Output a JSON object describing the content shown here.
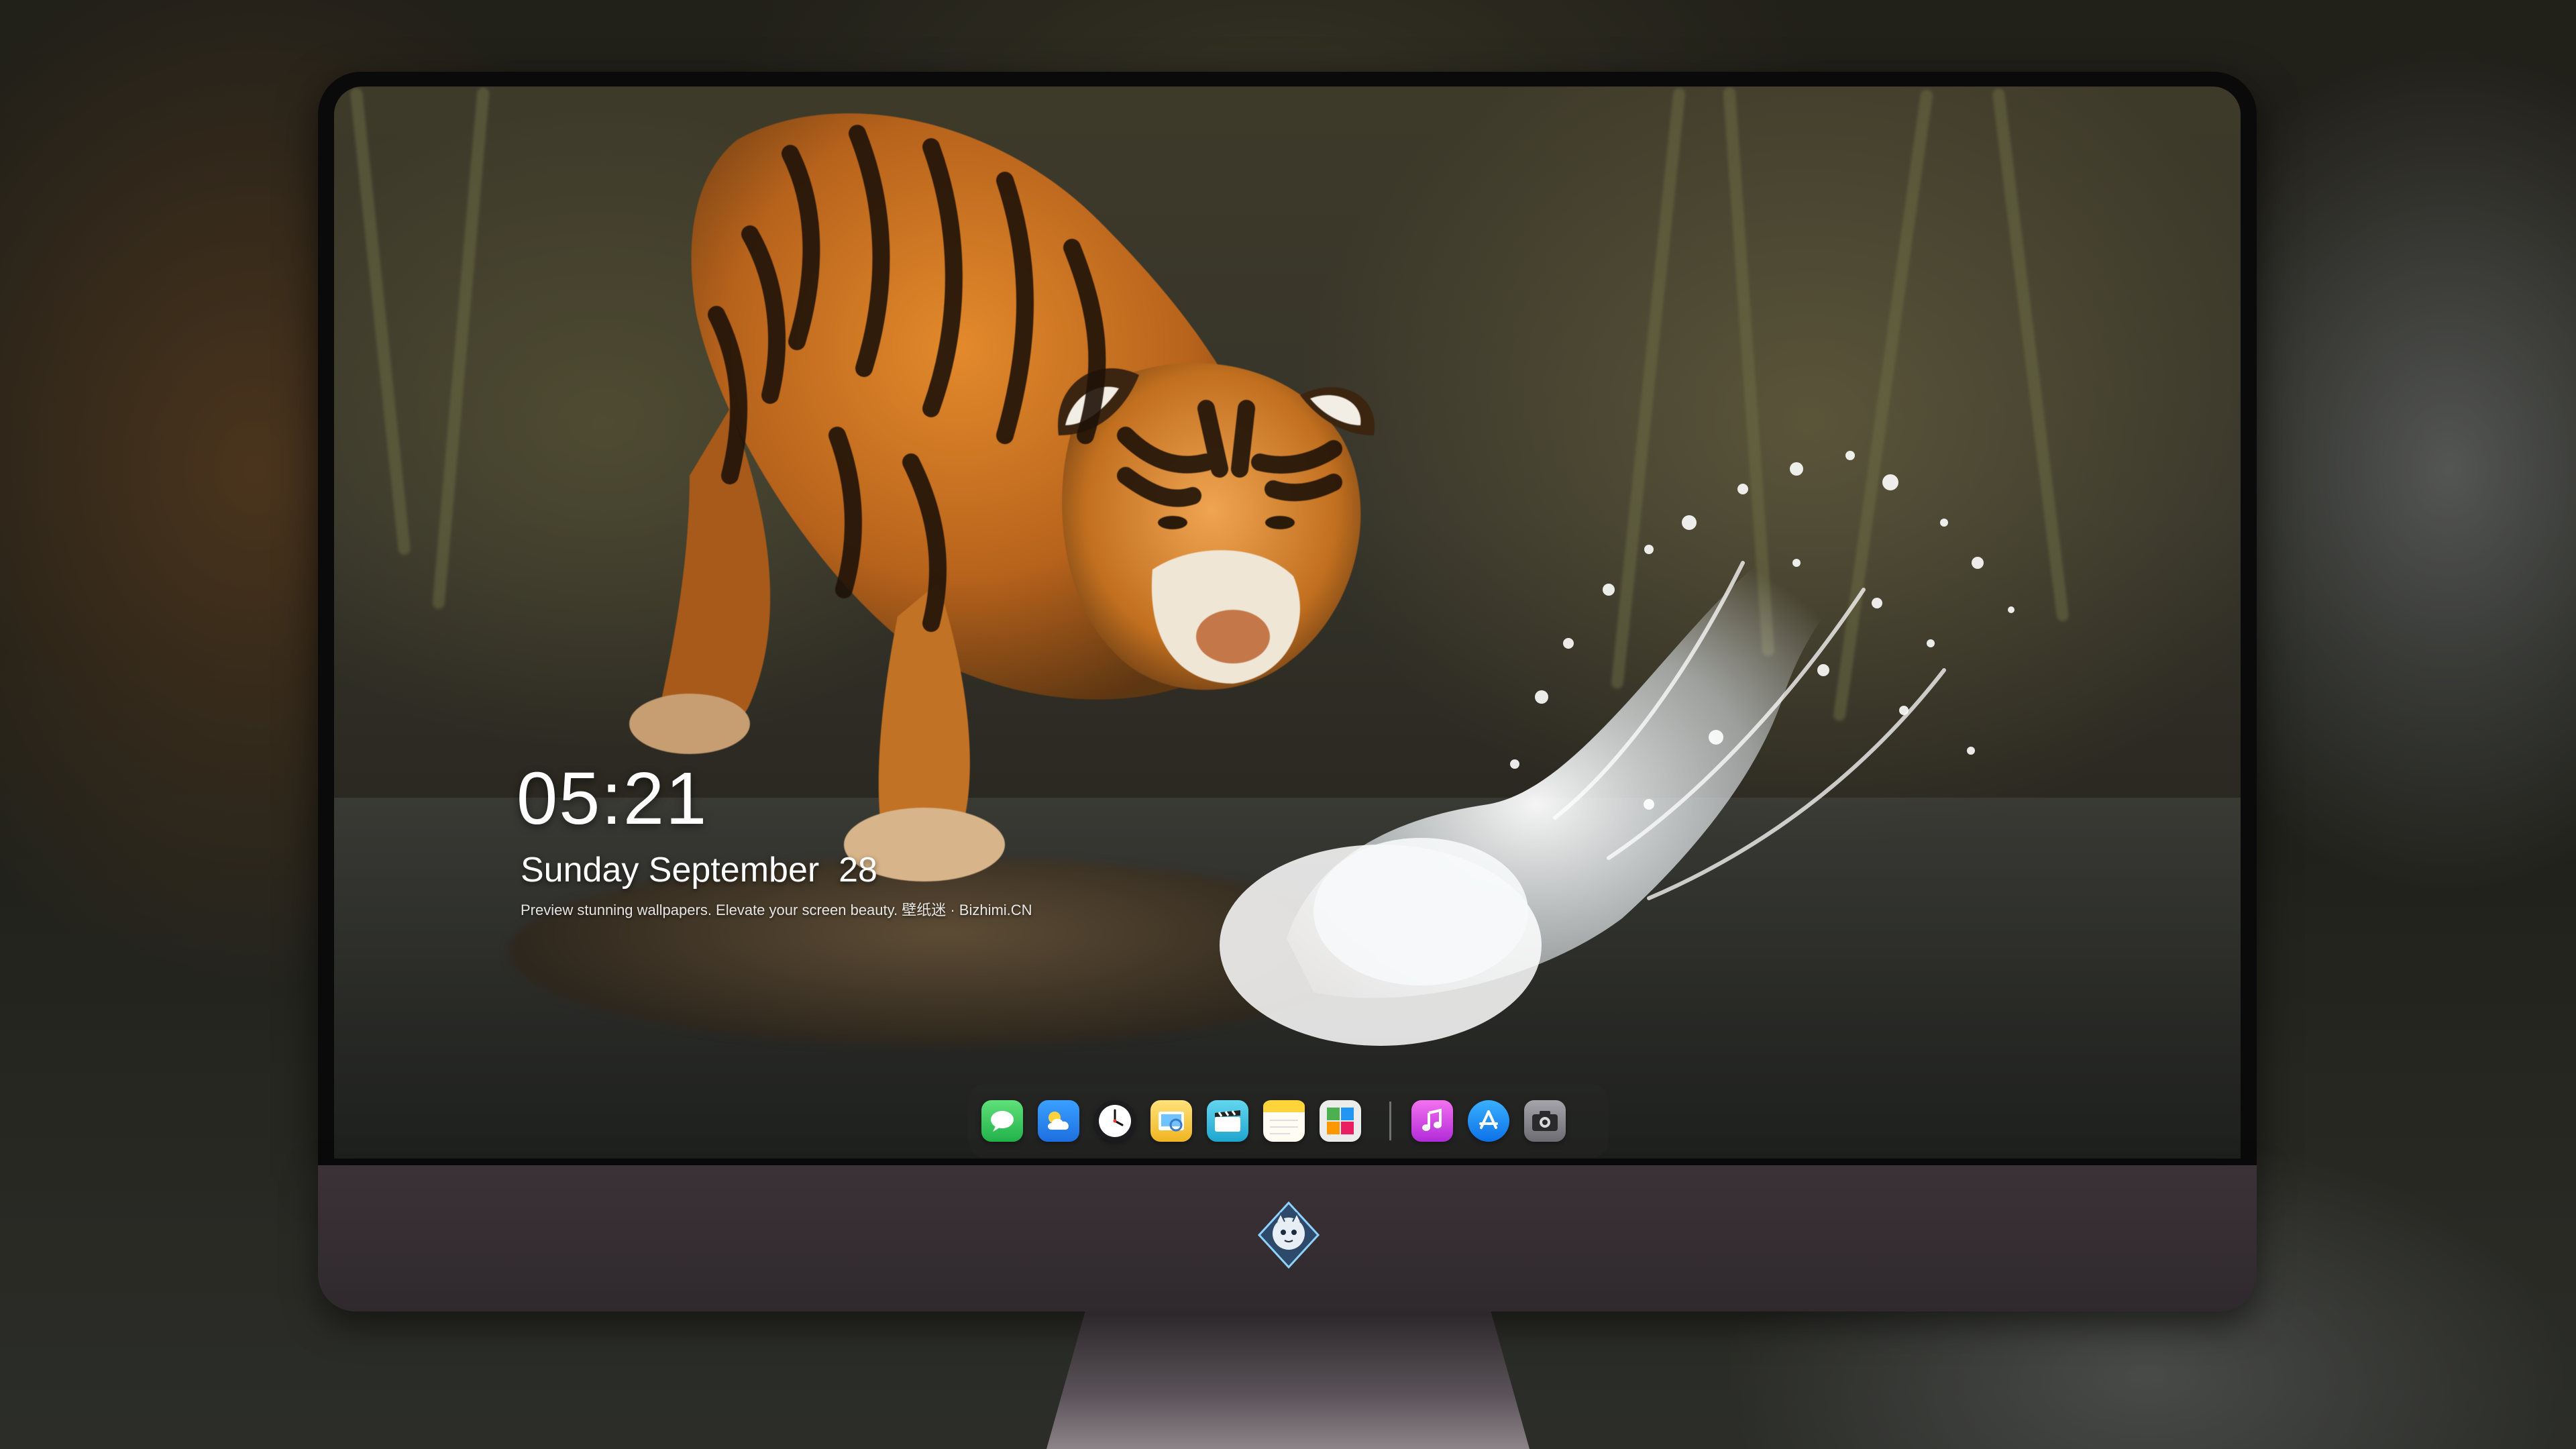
{
  "lockscreen": {
    "time": "05:21",
    "date": "Sunday September  28",
    "caption": "Preview stunning wallpapers. Elevate your screen beauty. 壁纸迷 · Bizhimi.CN"
  },
  "dock": {
    "apps": [
      {
        "icon": "messages-icon",
        "color": "#34c759"
      },
      {
        "icon": "weather-icon",
        "color": "#2f86f5"
      },
      {
        "icon": "clock-icon",
        "color": "#1c1c1e"
      },
      {
        "icon": "preview-icon",
        "color": "#f5c542"
      },
      {
        "icon": "clips-icon",
        "color": "#39c0e0"
      },
      {
        "icon": "notes-icon",
        "color": "#ffd43b"
      },
      {
        "icon": "photo-booth-icon",
        "color": "#e9e9e9"
      }
    ],
    "pinned": [
      {
        "icon": "music-icon",
        "color": "#d946ef"
      },
      {
        "icon": "app-store-icon",
        "color": "#1f8ef1"
      },
      {
        "icon": "camera-icon",
        "color": "#8e8e93"
      }
    ]
  },
  "colors": {
    "bezel": "#0a0a0b",
    "chin": "#3b3237",
    "text": "#ffffff"
  }
}
